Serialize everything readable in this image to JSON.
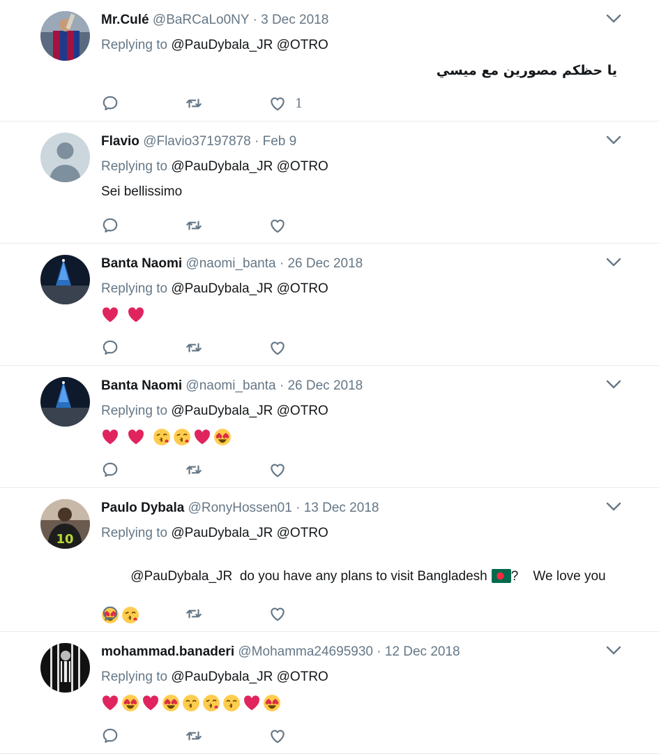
{
  "colors": {
    "text": "#14171a",
    "muted": "#657786",
    "divider": "#e6ecf0",
    "heart": "#e0245e"
  },
  "replying_label": "Replying to",
  "tweets": [
    {
      "name": "Mr.Culé",
      "handle": "@BaRCaLo0NY",
      "date": "3 Dec 2018",
      "mentions": "@PauDybala_JR @OTRO",
      "text": "يا حظكم مصورين مع ميسي",
      "likes": "1",
      "avatar": "barca-player-avatar"
    },
    {
      "name": "Flavio",
      "handle": "@Flavio37197878",
      "date": "Feb 9",
      "mentions": "@PauDybala_JR @OTRO",
      "text": "Sei bellissimo",
      "avatar": "default-avatar"
    },
    {
      "name": "Banta Naomi",
      "handle": "@naomi_banta",
      "date": "26 Dec 2018",
      "mentions": "@PauDybala_JR @OTRO",
      "emojis": [
        "heart",
        "heart"
      ],
      "avatar": "christmas-tree-avatar"
    },
    {
      "name": "Banta Naomi",
      "handle": "@naomi_banta",
      "date": "26 Dec 2018",
      "mentions": "@PauDybala_JR @OTRO",
      "emojis": [
        "heart",
        "heart",
        "kiss-face",
        "kiss-face",
        "heart",
        "heart-eyes"
      ],
      "avatar": "christmas-tree-avatar"
    },
    {
      "name": "Paulo Dybala",
      "handle": "@RonyHossen01",
      "date": "13 Dec 2018",
      "mentions": "@PauDybala_JR @OTRO",
      "text_part1": "@PauDybala_JR  do you have any plans to visit Bangladesh",
      "text_part2": "?    We love you",
      "emojis": [
        "heart-eyes",
        "kiss-face"
      ],
      "avatar": "jersey-10-avatar"
    },
    {
      "name": "mohammad.banaderi",
      "handle": "@Mohamma24695930",
      "date": "12 Dec 2018",
      "mentions": "@PauDybala_JR @OTRO",
      "emojis": [
        "heart",
        "heart-eyes",
        "heart",
        "heart-eyes",
        "kiss-closed-face",
        "kiss-face",
        "kiss-closed-face",
        "heart",
        "heart-eyes"
      ],
      "avatar": "bw-player-avatar"
    }
  ]
}
